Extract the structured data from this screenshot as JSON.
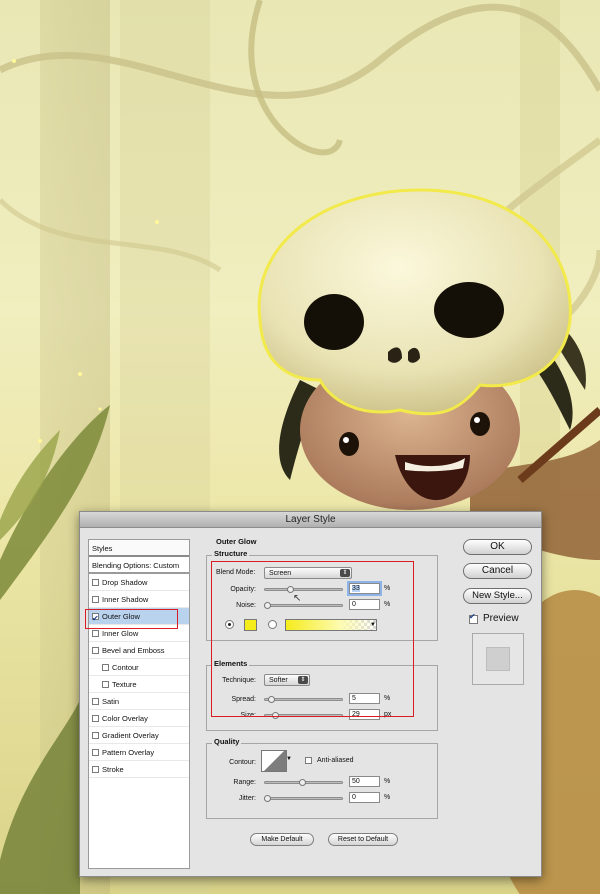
{
  "dialog": {
    "title": "Layer Style"
  },
  "styles_panel": {
    "header": "Styles",
    "blending": "Blending Options: Custom",
    "items": [
      {
        "label": "Drop Shadow",
        "checked": false,
        "sub": false
      },
      {
        "label": "Inner Shadow",
        "checked": false,
        "sub": false
      },
      {
        "label": "Outer Glow",
        "checked": true,
        "sub": false,
        "selected": true
      },
      {
        "label": "Inner Glow",
        "checked": false,
        "sub": false
      },
      {
        "label": "Bevel and Emboss",
        "checked": false,
        "sub": false
      },
      {
        "label": "Contour",
        "checked": false,
        "sub": true
      },
      {
        "label": "Texture",
        "checked": false,
        "sub": true
      },
      {
        "label": "Satin",
        "checked": false,
        "sub": false
      },
      {
        "label": "Color Overlay",
        "checked": false,
        "sub": false
      },
      {
        "label": "Gradient Overlay",
        "checked": false,
        "sub": false
      },
      {
        "label": "Pattern Overlay",
        "checked": false,
        "sub": false
      },
      {
        "label": "Stroke",
        "checked": false,
        "sub": false
      }
    ]
  },
  "outer_glow": {
    "title": "Outer Glow",
    "structure": {
      "title": "Structure",
      "blend_mode_label": "Blend Mode:",
      "blend_mode_value": "Screen",
      "opacity_label": "Opacity:",
      "opacity_value": "33",
      "opacity_level": 0.33,
      "noise_label": "Noise:",
      "noise_value": "0",
      "noise_level": 0,
      "percent": "%",
      "glow_color": "#f5ec1c"
    },
    "elements": {
      "title": "Elements",
      "technique_label": "Technique:",
      "technique_value": "Softer",
      "spread_label": "Spread:",
      "spread_value": "5",
      "spread_level": 0.05,
      "size_label": "Size:",
      "size_value": "29",
      "size_level": 0.12,
      "percent": "%",
      "px": "px"
    },
    "quality": {
      "title": "Quality",
      "contour_label": "Contour:",
      "anti_aliased_label": "Anti-aliased",
      "anti_aliased": false,
      "range_label": "Range:",
      "range_value": "50",
      "range_level": 0.5,
      "jitter_label": "Jitter:",
      "jitter_value": "0",
      "jitter_level": 0,
      "percent": "%"
    },
    "make_default": "Make Default",
    "reset_default": "Reset to Default"
  },
  "right": {
    "ok": "OK",
    "cancel": "Cancel",
    "new_style": "New Style...",
    "preview_label": "Preview",
    "preview_checked": true
  },
  "colors": {
    "highlight_box": "#d81d24",
    "selected_row": "#b9d2ee"
  }
}
